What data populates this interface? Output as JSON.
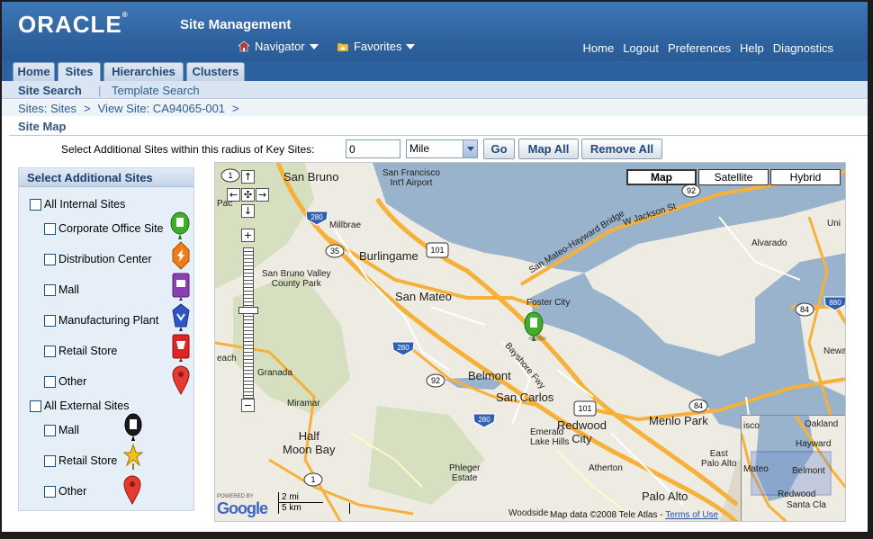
{
  "header": {
    "logo": "ORACLE",
    "app_title": "Site Management",
    "navigator": "Navigator",
    "favorites": "Favorites",
    "global_links": [
      "Home",
      "Logout",
      "Preferences",
      "Help",
      "Diagnostics"
    ]
  },
  "tabs": [
    {
      "label": "Home",
      "active": false
    },
    {
      "label": "Sites",
      "active": true
    },
    {
      "label": "Hierarchies",
      "active": false
    },
    {
      "label": "Clusters",
      "active": false
    }
  ],
  "subnav": {
    "active": "Site Search",
    "other": "Template Search"
  },
  "breadcrumbs": [
    {
      "label": "Sites: Sites"
    },
    {
      "label": "View Site: CA94065-001"
    }
  ],
  "breadcrumb_sep": ">",
  "section_title": "Site Map",
  "radius": {
    "label": "Select Additional Sites within this radius of Key Sites:",
    "value": "0",
    "unit": "Mile",
    "go": "Go",
    "map_all": "Map All",
    "remove_all": "Remove All"
  },
  "panel": {
    "title": "Select Additional Sites",
    "internal_header": "All Internal Sites",
    "internal_items": [
      "Corporate Office Site",
      "Distribution Center",
      "Mall",
      "Manufacturing Plant",
      "Retail Store",
      "Other"
    ],
    "external_header": "All External Sites",
    "external_items": [
      "Mall",
      "Retail Store",
      "Other"
    ]
  },
  "map": {
    "types": [
      "Map",
      "Satellite",
      "Hybrid"
    ],
    "active_type": "Map",
    "labels": {
      "san_bruno": "San Bruno",
      "sfo": "San Francisco\nInt'l Airport",
      "millbrae": "Millbrae",
      "burlingame": "Burlingame",
      "san_mateo": "San Mateo",
      "foster_city": "Foster City",
      "belmont": "Belmont",
      "san_carlos": "San Carlos",
      "redwood_city": "Redwood\nCity",
      "menlo_park": "Menlo Park",
      "east_palo_alto": "East\nPalo Alto",
      "palo_alto": "Palo Alto",
      "atherton": "Atherton",
      "half_moon_bay": "Half\nMoon Bay",
      "miramar": "Miramar",
      "granada": "Granada",
      "beach": "each",
      "pacifica": "Pac",
      "alvarado": "Alvarado",
      "newark": "Newa",
      "union": "Uni",
      "emerald": "Emerald\nLake Hills",
      "phleger": "Phleger\nEstate",
      "woodside": "Woodside",
      "bayshore": "Bayshore Fwy",
      "bridge": "San Mateo-Hayward Bridge",
      "w_jackson": "W Jackson St",
      "sbvalley": "San Bruno Valley\nCounty Park"
    },
    "shields": [
      "280",
      "35",
      "101",
      "92",
      "280",
      "92",
      "101",
      "280",
      "84",
      "84",
      "880",
      "1",
      "1"
    ],
    "minimap_labels": [
      "isco",
      "Oakland",
      "Hayward",
      "Mateo",
      "Belmont",
      "Redwood",
      "Santa Cla"
    ],
    "scale": {
      "mi": "2 mi",
      "km": "5 km"
    },
    "powered_by": "POWERED BY",
    "google": "Google",
    "copyright": "Map data ©2008 Tele Atlas -",
    "terms": "Terms of Use",
    "zoom_label": "1"
  },
  "colors": {
    "header_blue": "#2f63a0",
    "tab_text": "#23497a",
    "water": "#99b3cc",
    "freeway": "#f6b13a",
    "land": "#eeebe3"
  }
}
